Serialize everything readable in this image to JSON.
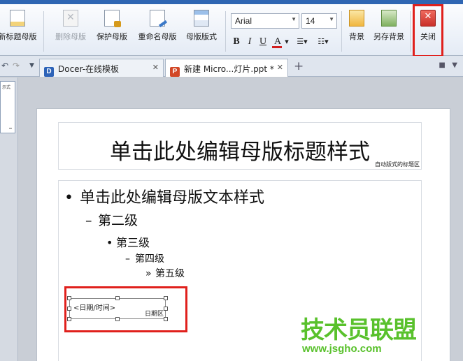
{
  "ribbon": {
    "buttons": {
      "new_title_master": "新标题母版",
      "delete_master": "删除母版",
      "protect_master": "保护母版",
      "rename_master": "重命名母版",
      "master_layout": "母版版式",
      "background": "背景",
      "save_background": "另存背景",
      "close": "关闭"
    },
    "font_name": "Arial",
    "font_size": "14",
    "format": {
      "bold": "B",
      "italic": "I",
      "underline": "U",
      "font_color": "A"
    },
    "accent_color": "#2f66b3",
    "highlight_color": "#e0201c"
  },
  "tabs": [
    {
      "label": "Docer-在线模板",
      "icon": "docer-icon",
      "icon_color": "#2d63b8"
    },
    {
      "label": "新建 Micro...灯片.ppt *",
      "icon": "ppt-icon",
      "icon_color": "#d24726"
    }
  ],
  "slide": {
    "title": "单击此处编辑母版标题样式",
    "title_placeholder_label": "自动版式的标题区",
    "levels": [
      {
        "bullet": "•",
        "text": "单击此处编辑母版文本样式"
      },
      {
        "bullet": "–",
        "text": "第二级"
      },
      {
        "bullet": "•",
        "text": "第三级"
      },
      {
        "bullet": "–",
        "text": "第四级"
      },
      {
        "bullet": "»",
        "text": "第五级"
      }
    ],
    "date_placeholder_text": "<日期/时间>",
    "date_placeholder_label": "日期区"
  },
  "watermark": {
    "cn": "技术员联盟",
    "url": "www.jsgho.com",
    "color": "#59c12c"
  }
}
